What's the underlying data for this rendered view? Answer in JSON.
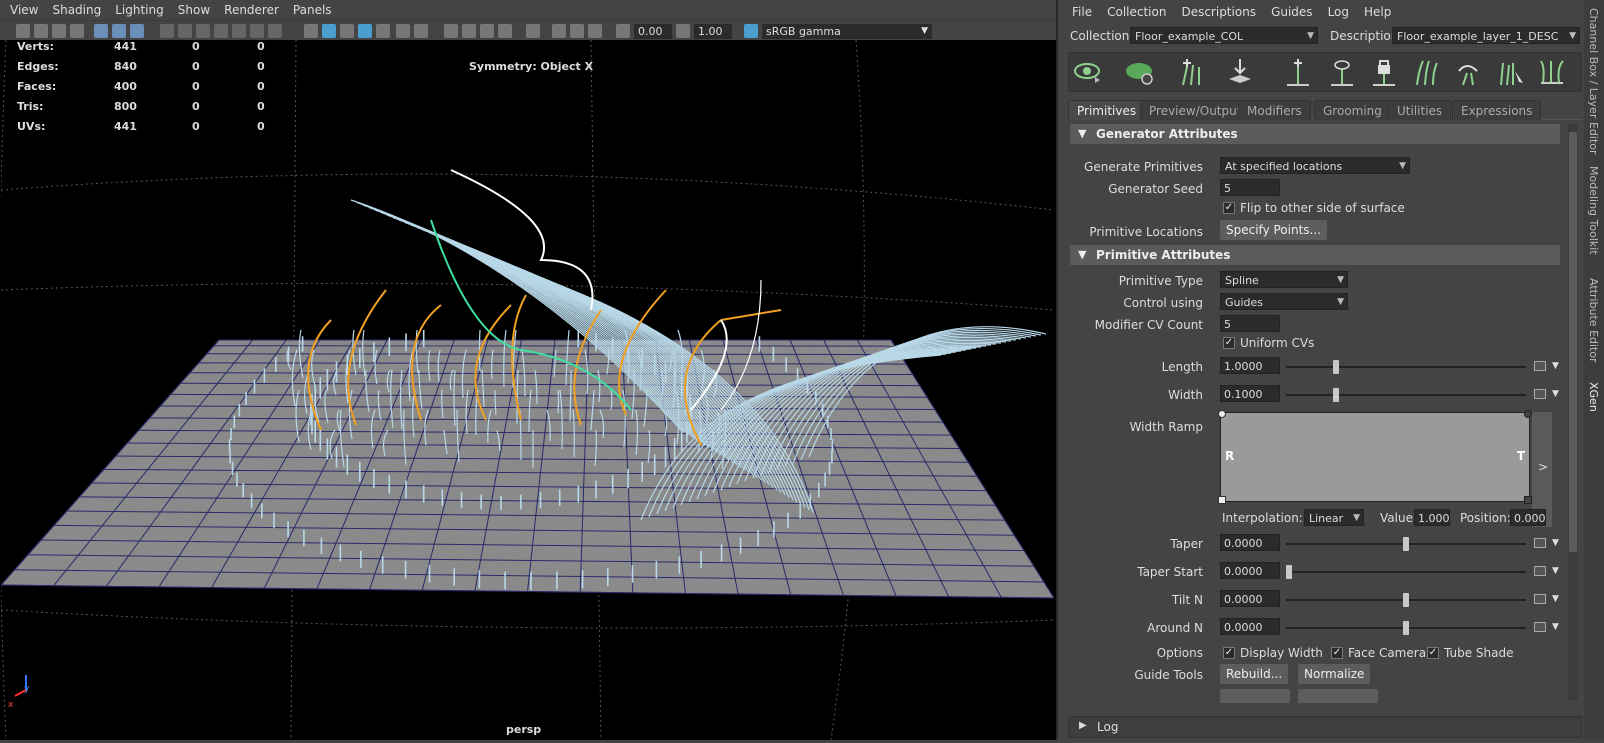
{
  "viewport": {
    "menu": [
      "View",
      "Shading",
      "Lighting",
      "Show",
      "Renderer",
      "Panels"
    ],
    "toolbar": {
      "field_a": "0.00",
      "field_b": "1.00",
      "color_space": "sRGB gamma"
    },
    "hud": {
      "rows": [
        {
          "label": "Verts:",
          "v1": "441",
          "v2": "0",
          "v3": "0"
        },
        {
          "label": "Edges:",
          "v1": "840",
          "v2": "0",
          "v3": "0"
        },
        {
          "label": "Faces:",
          "v1": "400",
          "v2": "0",
          "v3": "0"
        },
        {
          "label": "Tris:",
          "v1": "800",
          "v2": "0",
          "v3": "0"
        },
        {
          "label": "UVs:",
          "v1": "441",
          "v2": "0",
          "v3": "0"
        }
      ],
      "symmetry": "Symmetry: Object X"
    },
    "camera": "persp",
    "axis_y": "y",
    "axis_x": "x",
    "colors": {
      "guide_orange": "#f0a020",
      "guide_green": "#40e0a0",
      "guide_white": "#ffffff",
      "hair": "#b8d8e8",
      "floor": "#8a8a8a",
      "grid": "#2a2a6a"
    }
  },
  "panel": {
    "menu": [
      "File",
      "Collection",
      "Descriptions",
      "Guides",
      "Log",
      "Help"
    ],
    "collection_label": "Collection",
    "collection_value": "Floor_example_COL",
    "description_label": "Description",
    "description_value": "Floor_example_layer_1_DESC",
    "toolbar_icons": [
      "eye-guide-icon",
      "leaf-visibility-icon",
      "add-guides-icon",
      "place-guide-icon",
      "add-guide-icon",
      "show-guide-icon",
      "lock-guide-icon",
      "rebuild-guides-icon",
      "move-guide-icon",
      "sculpt-guides-icon",
      "grooming-guide-icon"
    ],
    "tabs": [
      "Primitives",
      "Preview/Output",
      "Modifiers",
      "Grooming",
      "Utilities",
      "Expressions"
    ],
    "active_tab": "Primitives",
    "gen_section": "Generator Attributes",
    "gen": {
      "generate_label": "Generate Primitives",
      "generate_value": "At specified locations",
      "seed_label": "Generator Seed",
      "seed_value": "5",
      "flip_label": "Flip to other side of surface",
      "locations_label": "Primitive Locations",
      "locations_button": "Specify Points..."
    },
    "prim_section": "Primitive Attributes",
    "prim": {
      "type_label": "Primitive Type",
      "type_value": "Spline",
      "control_label": "Control using",
      "control_value": "Guides",
      "cv_label": "Modifier CV Count",
      "cv_value": "5",
      "uniform_label": "Uniform CVs",
      "length_label": "Length",
      "length_value": "1.0000",
      "length_level": 0.2,
      "width_label": "Width",
      "width_value": "0.1000",
      "width_level": 0.2,
      "ramp_label": "Width Ramp",
      "ramp_left": "R",
      "ramp_right": "T",
      "ramp_expand": ">",
      "interp_label": "Interpolation:",
      "interp_value": "Linear",
      "value_label": "Value:",
      "value_value": "1.000",
      "position_label": "Position:",
      "position_value": "0.000",
      "taper_label": "Taper",
      "taper_value": "0.0000",
      "taper_level": 0.5,
      "taperstart_label": "Taper Start",
      "taperstart_value": "0.0000",
      "taperstart_level": 0.0,
      "tiltn_label": "Tilt N",
      "tiltn_value": "0.0000",
      "tiltn_level": 0.5,
      "aroundn_label": "Around N",
      "aroundn_value": "0.0000",
      "aroundn_level": 0.5,
      "options_label": "Options",
      "opt1": "Display Width",
      "opt2": "Face Camera",
      "opt3": "Tube Shade",
      "guidetools_label": "Guide Tools",
      "rebuild_button": "Rebuild...",
      "normalize_button": "Normalize"
    },
    "log_label": "Log",
    "side_tabs": [
      "Channel Box / Layer Editor",
      "Modeling Toolkit",
      "Attribute Editor",
      "XGen"
    ]
  }
}
